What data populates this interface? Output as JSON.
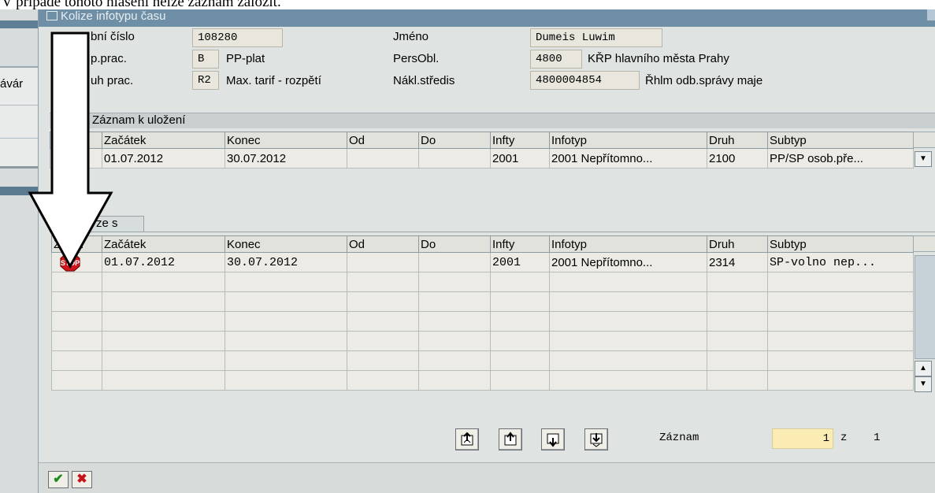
{
  "doc_text": "V případě tohoto hlášení nelze záznam založit.",
  "background": {
    "partial_label": "ávár"
  },
  "dialog": {
    "title": "Kolize infotypu času",
    "header": {
      "personal_number_label": "bní číslo",
      "personal_number_value": "108280",
      "group_label": "p.prac.",
      "group_code": "B",
      "group_text": "PP-plat",
      "kind_label": "uh prac.",
      "kind_code": "R2",
      "kind_text": "Max. tarif - rozpětí",
      "name_label": "Jméno",
      "name_value": "Dumeis Luwim",
      "persarea_label": "PersObl.",
      "persarea_code": "4800",
      "persarea_text": "KŘP hlavního města Prahy",
      "costcenter_label": "Nákl.středis",
      "costcenter_code": "4800004854",
      "costcenter_text": "Řhlm odb.správy maje"
    },
    "save_section": {
      "title": "Záznam k uložení",
      "columns": [
        "",
        "Začátek",
        "Konec",
        "Od",
        "Do",
        "Infty",
        "Infotyp",
        "Druh",
        "Subtyp"
      ],
      "rows": [
        {
          "mark": "",
          "start": "01.07.2012",
          "end": "30.07.2012",
          "from": "",
          "to": "",
          "infty": "2001",
          "infotyp": "2001 Nepřítomno...",
          "druh": "2100",
          "subtyp": "PP/SP osob.pře..."
        }
      ]
    },
    "collision_section": {
      "tab_label": "ze s",
      "columns": [
        "Zна...",
        "Začátek",
        "Konec",
        "Od",
        "Do",
        "Infty",
        "Infotyp",
        "Druh",
        "Subtyp"
      ],
      "rows": [
        {
          "mark": "STOP",
          "start": "01.07.2012",
          "end": "30.07.2012",
          "from": "",
          "to": "",
          "infty": "2001",
          "infotyp": "2001 Nepřítomno...",
          "druh": "2314",
          "subtyp": "SP-volno nep..."
        }
      ],
      "empty_rows": 6
    },
    "record": {
      "label": "Záznam",
      "current": "1",
      "of": "z",
      "total": "1"
    },
    "icons": {
      "confirm": "check-icon",
      "cancel": "cancel-icon",
      "stop": "stop-sign-icon"
    },
    "colors": {
      "title_bar": "#6e8fa6",
      "stop_red": "#d0161b",
      "record_field": "#fbecb3"
    }
  }
}
